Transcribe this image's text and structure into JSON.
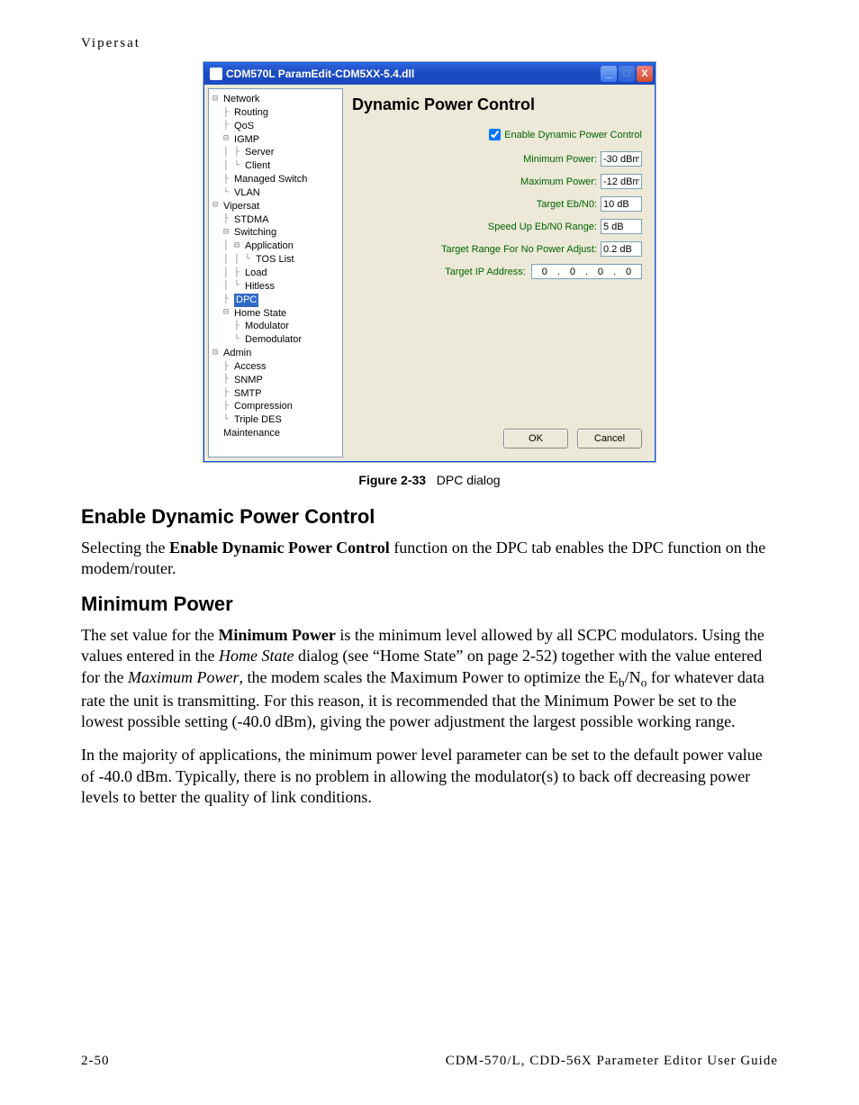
{
  "runningHeader": "Vipersat",
  "dialog": {
    "title": "CDM570L ParamEdit-CDM5XX-5.4.dll",
    "paneTitle": "Dynamic Power Control",
    "enableLabel": "Enable Dynamic Power Control",
    "fields": {
      "minPower": {
        "label": "Minimum Power:",
        "value": "-30 dBm"
      },
      "maxPower": {
        "label": "Maximum Power:",
        "value": "-12 dBm"
      },
      "targetEbN0": {
        "label": "Target Eb/N0:",
        "value": "10 dB"
      },
      "speedUp": {
        "label": "Speed Up Eb/N0 Range:",
        "value": "5 dB"
      },
      "noPowerAdj": {
        "label": "Target Range For No Power Adjust:",
        "value": "0.2 dB"
      },
      "targetIp": {
        "label": "Target IP Address:",
        "a": "0",
        "b": "0",
        "c": "0",
        "d": "0"
      }
    },
    "okLabel": "OK",
    "cancelLabel": "Cancel",
    "tree": {
      "network": "Network",
      "routing": "Routing",
      "qos": "QoS",
      "igmp": "IGMP",
      "server": "Server",
      "client": "Client",
      "managedSwitch": "Managed Switch",
      "vlan": "VLAN",
      "vipersat": "Vipersat",
      "stdma": "STDMA",
      "switching": "Switching",
      "application": "Application",
      "tosList": "TOS List",
      "load": "Load",
      "hitless": "Hitless",
      "dpc": "DPC",
      "homeState": "Home State",
      "modulator": "Modulator",
      "demodulator": "Demodulator",
      "admin": "Admin",
      "access": "Access",
      "snmp": "SNMP",
      "smtp": "SMTP",
      "compression": "Compression",
      "tripleDes": "Triple DES",
      "maintenance": "Maintenance"
    }
  },
  "caption": {
    "label": "Figure 2-33",
    "text": "DPC dialog"
  },
  "sections": {
    "s1": {
      "heading": "Enable Dynamic Power Control",
      "p1a": "Selecting the ",
      "p1b": "Enable Dynamic Power Control",
      "p1c": " function on the DPC tab enables the DPC function on the modem/router."
    },
    "s2": {
      "heading": "Minimum Power",
      "p1a": "The set value for the ",
      "p1b": "Minimum Power",
      "p1c": " is the minimum level allowed by all SCPC modulators. Using the values entered in the ",
      "p1d": "Home State",
      "p1e": " dialog (see “Home State” on page 2-52) together with the value entered for the ",
      "p1f": "Maximum Power",
      "p1g": ", the modem scales the Maximum Power to optimize the E",
      "p1h": "/N",
      "p1i": " for whatever data rate the unit is transmitting. For this reason, it is recommended that the Minimum Power be set to the lowest possible setting (-40.0 dBm), giving the power adjustment the largest possible working range.",
      "p2": "In the majority of applications, the minimum power level parameter can be set to the default power value of -40.0 dBm. Typically, there is no problem in allowing the modulator(s) to back off decreasing power levels to better the quality of link conditions."
    }
  },
  "footer": {
    "left": "2-50",
    "right": "CDM-570/L, CDD-56X Parameter Editor User Guide"
  }
}
